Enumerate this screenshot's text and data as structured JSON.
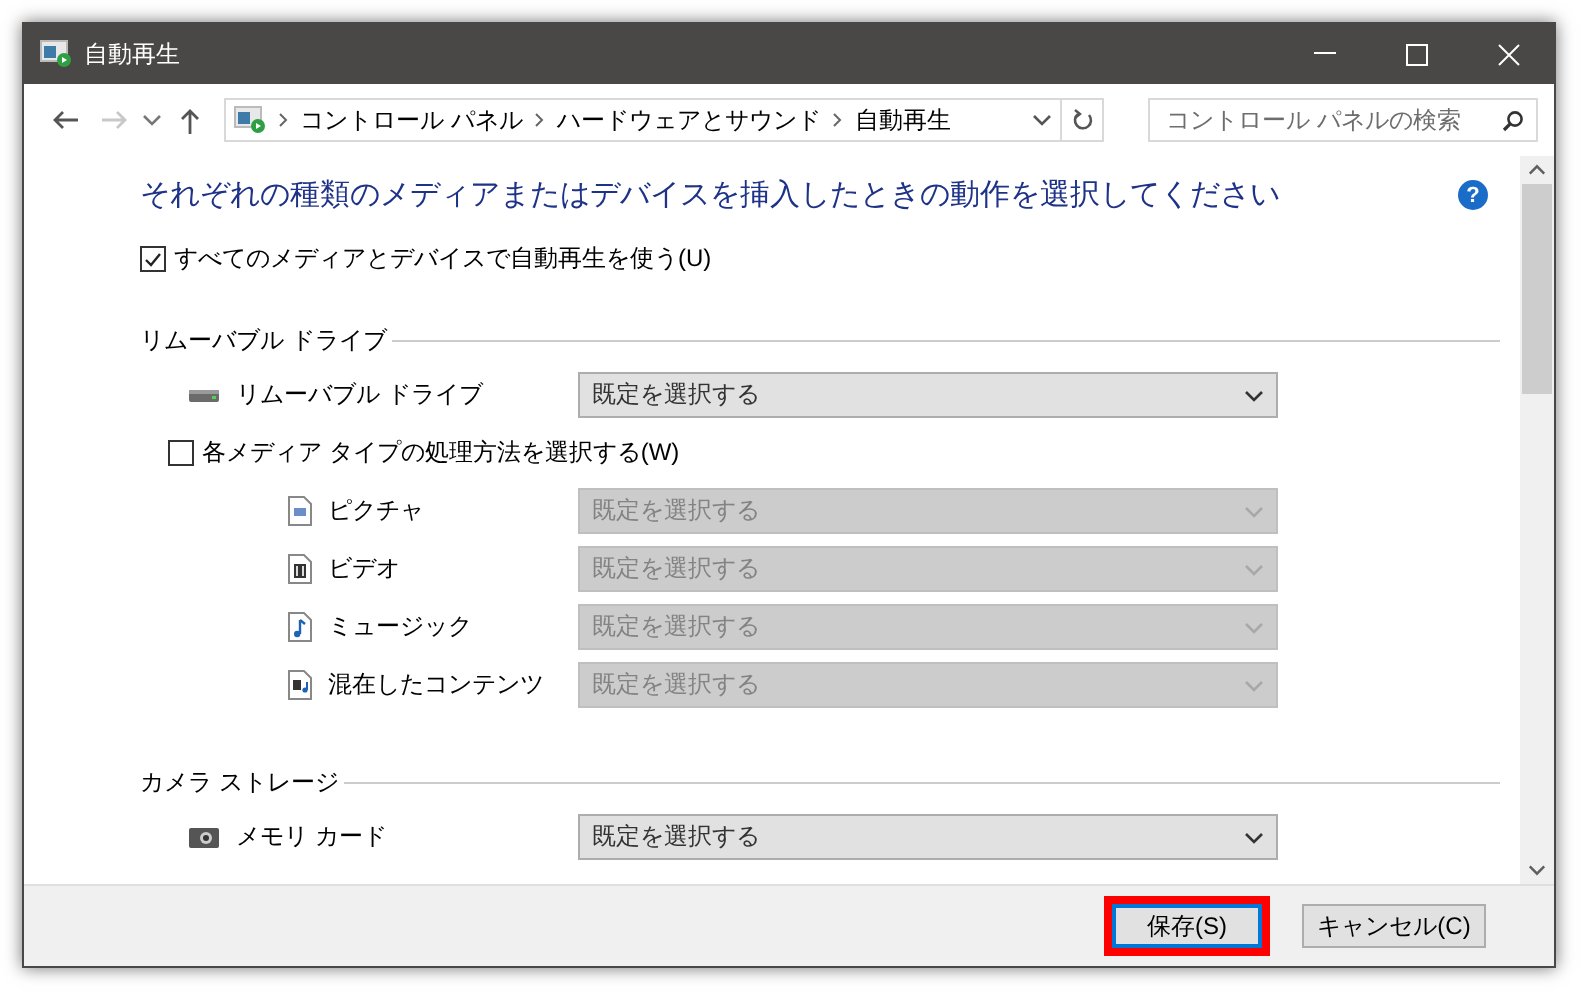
{
  "window": {
    "title": "自動再生"
  },
  "nav": {
    "breadcrumbs": [
      "コントロール パネル",
      "ハードウェアとサウンド",
      "自動再生"
    ],
    "search": {
      "placeholder": "コントロール パネルの検索"
    }
  },
  "heading": "それぞれの種類のメディアまたはデバイスを挿入したときの動作を選択してください",
  "help": "?",
  "use_autoplay": {
    "label": "すべてのメディアとデバイスで自動再生を使う(U)",
    "checked": true
  },
  "sections": [
    {
      "title": "リムーバブル ドライブ",
      "items": [
        {
          "kind": "drive",
          "label": "リムーバブル ドライブ",
          "value": "既定を選択する",
          "disabled": false
        },
        {
          "kind": "checkbox",
          "label": "各メディア タイプの処理方法を選択する(W)",
          "checked": false
        },
        {
          "kind": "picture",
          "label": "ピクチャ",
          "value": "既定を選択する",
          "disabled": true
        },
        {
          "kind": "video",
          "label": "ビデオ",
          "value": "既定を選択する",
          "disabled": true
        },
        {
          "kind": "music",
          "label": "ミュージック",
          "value": "既定を選択する",
          "disabled": true
        },
        {
          "kind": "mixed",
          "label": "混在したコンテンツ",
          "value": "既定を選択する",
          "disabled": true
        }
      ]
    },
    {
      "title": "カメラ ストレージ",
      "items": [
        {
          "kind": "memory-card",
          "label": "メモリ カード",
          "value": "既定を選択する",
          "disabled": false
        }
      ]
    }
  ],
  "buttons": [
    {
      "label": "保存(S)",
      "focused": true,
      "highlighted": true
    },
    {
      "label": "キャンセル(C)",
      "focused": false,
      "highlighted": false
    }
  ]
}
